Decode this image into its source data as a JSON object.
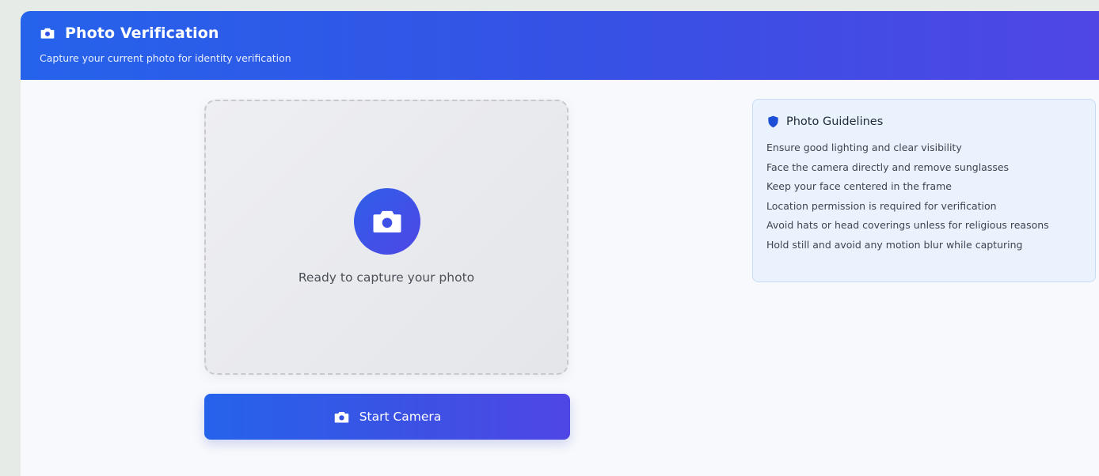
{
  "header": {
    "icon": "camera-icon",
    "title": "Photo Verification",
    "subtitle": "Capture your current photo for identity verification"
  },
  "capture": {
    "icon": "camera-icon",
    "status_text": "Ready to capture your photo"
  },
  "start_button": {
    "icon": "camera-icon",
    "label": "Start Camera"
  },
  "guidelines": {
    "icon": "shield-icon",
    "title": "Photo Guidelines",
    "items": [
      "Ensure good lighting and clear visibility",
      "Face the camera directly and remove sunglasses",
      "Keep your face centered in the frame",
      "Location permission is required for verification",
      "Avoid hats or head coverings unless for religious reasons",
      "Hold still and avoid any motion blur while capturing"
    ]
  },
  "colors": {
    "accent_start": "#2563eb",
    "accent_end": "#4f46e5",
    "guidelines_bg": "#eaf2fd"
  }
}
